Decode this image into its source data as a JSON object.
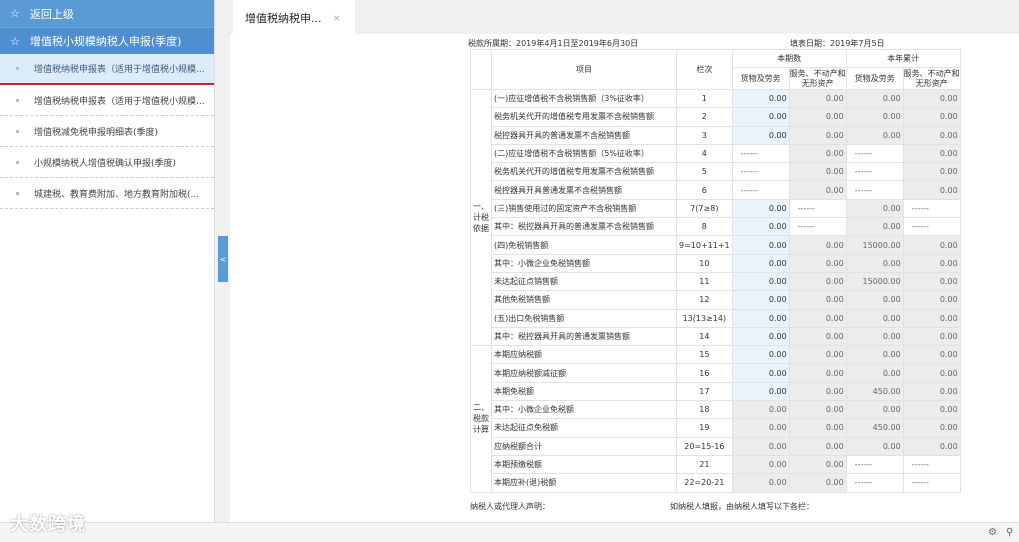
{
  "sidebar": {
    "back_label": "返回上级",
    "group_label": "增值税小规模纳税人申报(季度)",
    "items": [
      {
        "label": "增值税纳税申报表（适用于增值税小规模..."
      },
      {
        "label": "增值税纳税申报表（适用于增值税小规模..."
      },
      {
        "label": "增值税减免税申报明细表(季度)"
      },
      {
        "label": "小规模纳税人增值税确认申报(季度)"
      },
      {
        "label": "城建税、教育费附加、地方教育附加税(..."
      }
    ]
  },
  "tab": {
    "label": "增值税纳税申...",
    "close": "×"
  },
  "form": {
    "period": "税款所属期：2019年4月1日至2019年6月30日",
    "fill_date": "填表日期：2019年7月5日",
    "headers": {
      "item": "项目",
      "col": "栏次",
      "current": "本期数",
      "ytd": "本年累计",
      "goods": "货物及劳务",
      "services": "服务、不动产和无形资产"
    },
    "section1": "一、计税依据",
    "section2": "二、税款计算",
    "rows": [
      {
        "item": "(一)应征增值税不含税销售额（3%征收率）",
        "col": "1",
        "v": [
          "0.00",
          "0.00",
          "0.00",
          "0.00"
        ]
      },
      {
        "item": "税务机关代开的增值税专用发票不含税销售额",
        "col": "2",
        "v": [
          "0.00",
          "0.00",
          "0.00",
          "0.00"
        ]
      },
      {
        "item": "税控器具开具的普通发票不含税销售额",
        "col": "3",
        "v": [
          "0.00",
          "0.00",
          "0.00",
          "0.00"
        ]
      },
      {
        "item": "(二)应征增值税不含税销售额（5%征收率）",
        "col": "4",
        "v": [
          "------",
          "0.00",
          "------",
          "0.00"
        ]
      },
      {
        "item": "税务机关代开的增值税专用发票不含税销售额",
        "col": "5",
        "v": [
          "------",
          "0.00",
          "------",
          "0.00"
        ]
      },
      {
        "item": "税控器具开具普通发票不含税销售额",
        "col": "6",
        "v": [
          "------",
          "0.00",
          "------",
          "0.00"
        ]
      },
      {
        "item": "(三)销售使用过的固定资产不含税销售额",
        "col": "7(7≥8)",
        "v": [
          "0.00",
          "------",
          "0.00",
          "------"
        ]
      },
      {
        "item": "其中：税控器具开具的普通发票不含税销售额",
        "col": "8",
        "v": [
          "0.00",
          "------",
          "0.00",
          "------"
        ]
      },
      {
        "item": "(四)免税销售额",
        "col": "9=10+11+1",
        "v": [
          "0.00",
          "0.00",
          "15000.00",
          "0.00"
        ]
      },
      {
        "item": "其中：小微企业免税销售额",
        "col": "10",
        "v": [
          "0.00",
          "0.00",
          "0.00",
          "0.00"
        ]
      },
      {
        "item": "未达起征点销售额",
        "col": "11",
        "v": [
          "0.00",
          "0.00",
          "15000.00",
          "0.00"
        ]
      },
      {
        "item": "其他免税销售额",
        "col": "12",
        "v": [
          "0.00",
          "0.00",
          "0.00",
          "0.00"
        ]
      },
      {
        "item": "(五)出口免税销售额",
        "col": "13(13≥14)",
        "v": [
          "0.00",
          "0.00",
          "0.00",
          "0.00"
        ]
      },
      {
        "item": "其中：税控器具开具的普通发票销售额",
        "col": "14",
        "v": [
          "0.00",
          "0.00",
          "0.00",
          "0.00"
        ]
      },
      {
        "item": "本期应纳税额",
        "col": "15",
        "v": [
          "0.00",
          "0.00",
          "0.00",
          "0.00"
        ]
      },
      {
        "item": "本期应纳税额减征额",
        "col": "16",
        "v": [
          "0.00",
          "0.00",
          "0.00",
          "0.00"
        ]
      },
      {
        "item": "本期免税额",
        "col": "17",
        "v": [
          "0.00",
          "0.00",
          "450.00",
          "0.00"
        ]
      },
      {
        "item": "其中：小微企业免税额",
        "col": "18",
        "v": [
          "0.00",
          "0.00",
          "0.00",
          "0.00"
        ]
      },
      {
        "item": "未达起征点免税额",
        "col": "19",
        "v": [
          "0.00",
          "0.00",
          "450.00",
          "0.00"
        ]
      },
      {
        "item": "应纳税额合计",
        "col": "20=15-16",
        "v": [
          "0.00",
          "0.00",
          "0.00",
          "0.00"
        ]
      },
      {
        "item": "本期预缴税额",
        "col": "21",
        "v": [
          "0.00",
          "0.00",
          "------",
          "------"
        ]
      },
      {
        "item": "本期应补(退)税额",
        "col": "22=20-21",
        "v": [
          "0.00",
          "0.00",
          "------",
          "------"
        ]
      }
    ],
    "declare": "纳税人或代理人声明：",
    "declare2": "如纳税人填报，由纳税人填写以下各栏："
  },
  "collapse_arrow": "<",
  "watermark": "大数跨境"
}
